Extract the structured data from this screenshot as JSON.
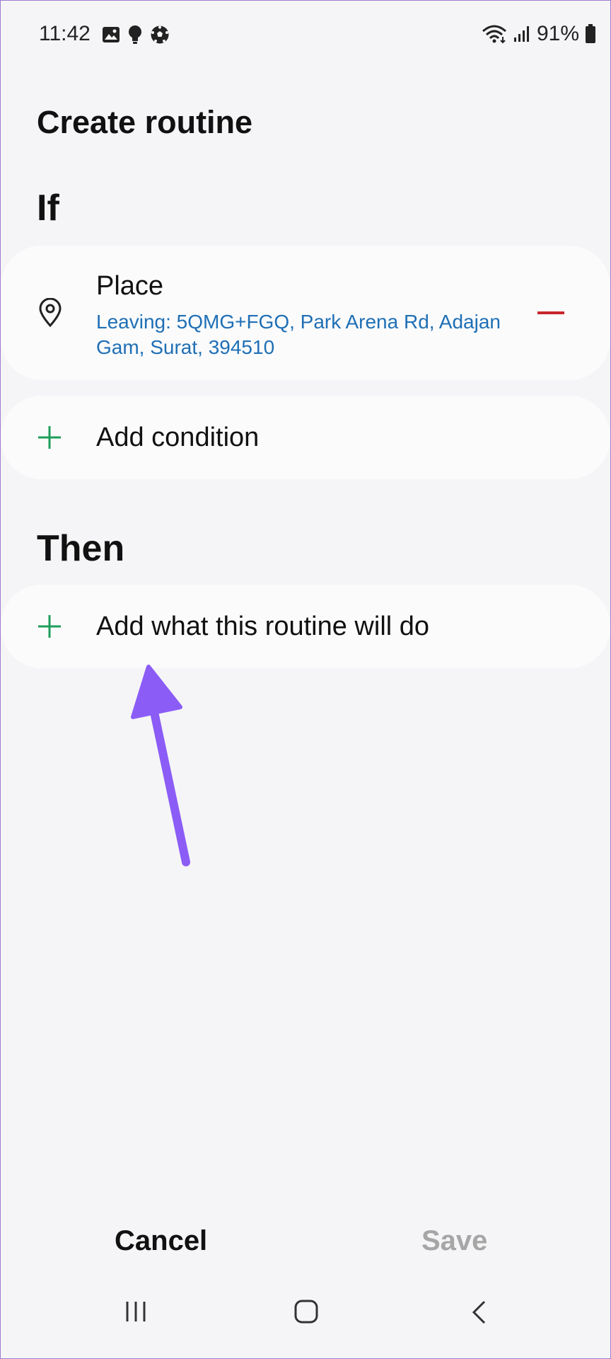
{
  "status_bar": {
    "time": "11:42",
    "battery": "91%",
    "left_icons": [
      "image-icon",
      "bulb-icon",
      "soccer-ball-icon"
    ],
    "right_icons": [
      "wifi-icon",
      "signal-icon",
      "battery-icon"
    ]
  },
  "page": {
    "title": "Create routine",
    "if_heading": "If",
    "then_heading": "Then"
  },
  "condition": {
    "title": "Place",
    "detail": "Leaving: 5QMG+FGQ, Park Arena Rd, Adajan Gam, Surat,  394510",
    "icon": "location-pin-icon"
  },
  "add_condition": {
    "label": "Add condition"
  },
  "add_action": {
    "label": "Add what this routine will do"
  },
  "footer": {
    "cancel_label": "Cancel",
    "save_label": "Save"
  },
  "colors": {
    "accent_green": "#1e9e5a",
    "remove_red": "#c8262b",
    "link_blue": "#1f6fb5",
    "annotation_purple": "#8b5cf6"
  }
}
